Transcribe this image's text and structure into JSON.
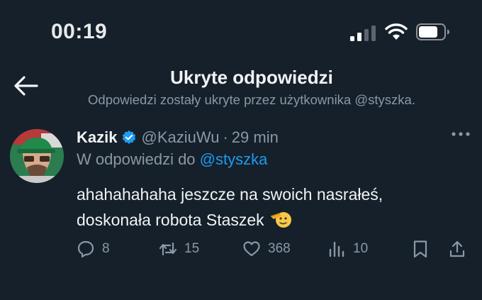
{
  "status_bar": {
    "time": "00:19",
    "signal_icon": "cellular-signal-icon",
    "wifi_icon": "wifi-icon",
    "battery_icon": "battery-icon"
  },
  "header": {
    "back_icon": "back-arrow-icon",
    "title": "Ukryte odpowiedzi",
    "subtitle": "Odpowiedzi zostały ukryte przez użytkownika @styszka."
  },
  "tweet": {
    "display_name": "Kazik",
    "verified_icon": "verified-badge-icon",
    "handle": "@KaziuWu",
    "separator": "·",
    "time_ago": "29 min",
    "reply_prefix": "W odpowiedzi do",
    "reply_mention": "@styszka",
    "text": "ahahahahaha jeszcze na swoich nasrałeś, doskonała robota Staszek",
    "emoji": "saluting-face-emoji",
    "more_icon": "more-options-icon"
  },
  "actions": {
    "reply_count": "8",
    "retweet_count": "15",
    "like_count": "368",
    "views_count": "10"
  },
  "colors": {
    "background": "#15202b",
    "text": "#e7e9ea",
    "secondary_text": "#8b98a5",
    "accent": "#1d9bf0"
  }
}
